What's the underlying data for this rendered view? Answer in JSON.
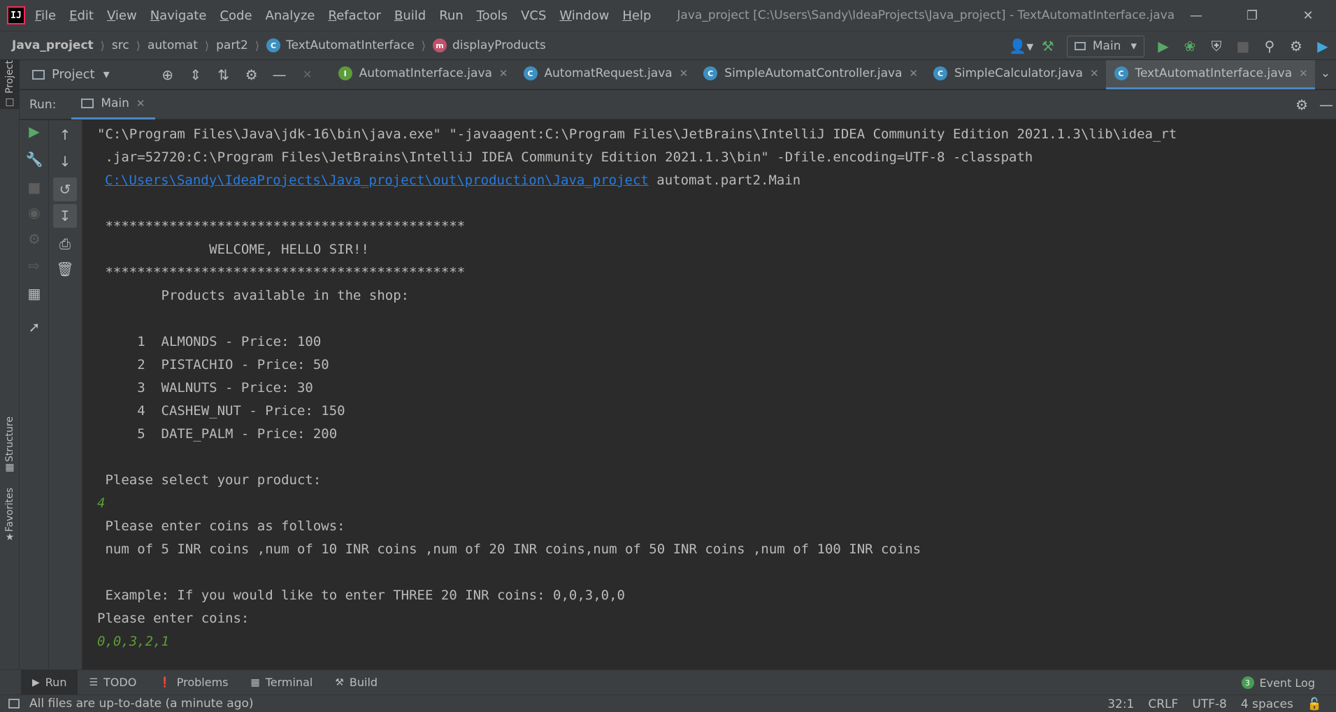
{
  "menubar": {
    "logo": "IJ",
    "items": [
      {
        "label": "File",
        "mnemonic": "F",
        "rest": "ile"
      },
      {
        "label": "Edit",
        "mnemonic": "E",
        "rest": "dit"
      },
      {
        "label": "View",
        "mnemonic": "V",
        "rest": "iew"
      },
      {
        "label": "Navigate",
        "mnemonic": "N",
        "rest": "avigate"
      },
      {
        "label": "Code",
        "mnemonic": "C",
        "rest": "ode"
      },
      {
        "label": "Analyze",
        "mnemonic": "",
        "rest": "Analyze"
      },
      {
        "label": "Refactor",
        "mnemonic": "R",
        "rest": "efactor"
      },
      {
        "label": "Build",
        "mnemonic": "B",
        "rest": "uild"
      },
      {
        "label": "Run",
        "mnemonic": "",
        "rest": "Run"
      },
      {
        "label": "Tools",
        "mnemonic": "T",
        "rest": "ools"
      },
      {
        "label": "VCS",
        "mnemonic": "",
        "rest": "VCS"
      },
      {
        "label": "Window",
        "mnemonic": "W",
        "rest": "indow"
      },
      {
        "label": "Help",
        "mnemonic": "H",
        "rest": "elp"
      }
    ],
    "window_title": "Java_project [C:\\Users\\Sandy\\IdeaProjects\\Java_project] - TextAutomatInterface.java"
  },
  "navbar": {
    "breadcrumbs": [
      "Java_project",
      "src",
      "automat",
      "part2",
      "TextAutomatInterface",
      "displayProducts"
    ],
    "run_config": "Main"
  },
  "toolrow": {
    "project_label": "Project",
    "tabs": [
      {
        "label": "AutomatInterface.java",
        "kind": "I"
      },
      {
        "label": "AutomatRequest.java",
        "kind": "C"
      },
      {
        "label": "SimpleAutomatController.java",
        "kind": "C"
      },
      {
        "label": "SimpleCalculator.java",
        "kind": "C"
      },
      {
        "label": "TextAutomatInterface.java",
        "kind": "C"
      }
    ]
  },
  "left_strip": {
    "project": "Project",
    "structure": "Structure",
    "favorites": "Favorites"
  },
  "run": {
    "label": "Run:",
    "tab": "Main"
  },
  "console": {
    "lines": [
      "\"C:\\Program Files\\Java\\jdk-16\\bin\\java.exe\" \"-javaagent:C:\\Program Files\\JetBrains\\IntelliJ IDEA Community Edition 2021.1.3\\lib\\idea_rt",
      " .jar=52720:C:\\Program Files\\JetBrains\\IntelliJ IDEA Community Edition 2021.1.3\\bin\" -Dfile.encoding=UTF-8 -classpath",
      "C:\\Users\\Sandy\\IdeaProjects\\Java_project\\out\\production\\Java_project",
      "",
      " *********************************************",
      "              WELCOME, HELLO SIR!!",
      " *********************************************",
      "        Products available in the shop:",
      "",
      "     1  ALMONDS - Price: 100",
      "     2  PISTACHIO - Price: 50",
      "     3  WALNUTS - Price: 30",
      "     4  CASHEW_NUT - Price: 150",
      "     5  DATE_PALM - Price: 200",
      "",
      " Please select your product:",
      "4",
      " Please enter coins as follows:",
      " num of 5 INR coins ,num of 10 INR coins ,num of 20 INR coins,num of 50 INR coins ,num of 100 INR coins",
      "",
      " Example: If you would like to enter THREE 20 INR coins: 0,0,3,0,0",
      "Please enter coins:",
      "0,0,3,2,1"
    ],
    "classpath_tail": " automat.part2.Main"
  },
  "bottombar": {
    "tabs": [
      "Run",
      "TODO",
      "Problems",
      "Terminal",
      "Build"
    ],
    "event_log": "Event Log",
    "event_count": "3"
  },
  "statusbar": {
    "message": "All files are up-to-date (a minute ago)",
    "position": "32:1",
    "line_sep": "CRLF",
    "encoding": "UTF-8",
    "indent": "4 spaces"
  },
  "colors": {
    "bg": "#2b2b2b",
    "panel": "#3c3f41",
    "accent": "#4a88c7",
    "link": "#287bde",
    "user_input": "#5c9d3a",
    "run_green": "#59a869"
  }
}
